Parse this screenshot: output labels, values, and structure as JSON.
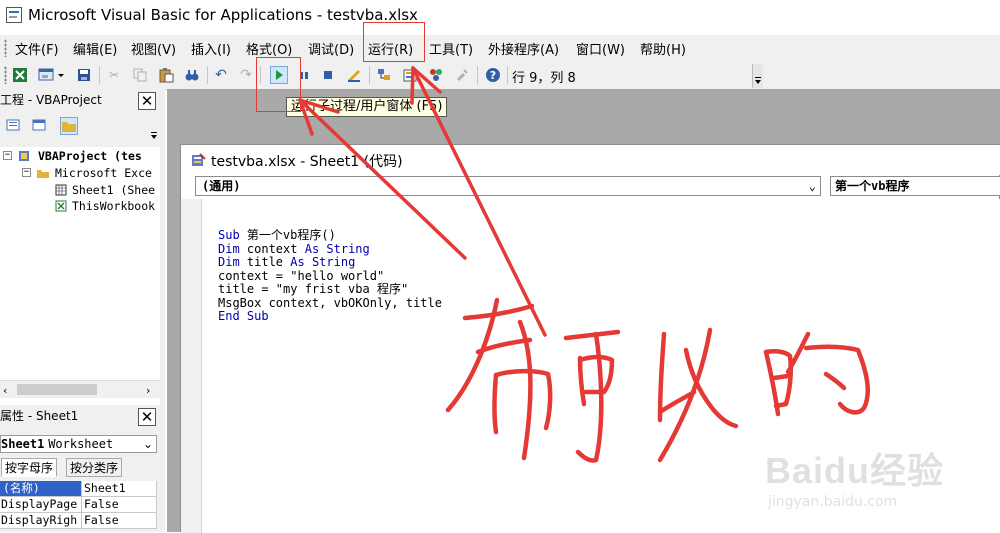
{
  "window": {
    "title": "Microsoft Visual Basic for Applications - testvba.xlsx"
  },
  "menu": {
    "items": [
      "文件(F)",
      "编辑(E)",
      "视图(V)",
      "插入(I)",
      "格式(O)",
      "调试(D)",
      "运行(R)",
      "工具(T)",
      "外接程序(A)",
      "窗口(W)",
      "帮助(H)"
    ]
  },
  "toolbar": {
    "position": "行 9，列 8",
    "tooltip": "运行子过程/用户窗体 (F5)"
  },
  "project_panel": {
    "title": "工程 - VBAProject",
    "tree": [
      "VBAProject (tes",
      "Microsoft Exce",
      "Sheet1 (Shee",
      "ThisWorkbook"
    ]
  },
  "properties_panel": {
    "title": "属性 - Sheet1",
    "object_name": "Sheet1",
    "object_type": "Worksheet",
    "tabs": [
      "按字母序",
      "按分类序"
    ],
    "rows": [
      {
        "name": "(名称)",
        "value": "Sheet1"
      },
      {
        "name": "DisplayPage",
        "value": "False"
      },
      {
        "name": "DisplayRigh",
        "value": "False"
      }
    ]
  },
  "code_window": {
    "title": "testvba.xlsx - Sheet1 (代码)",
    "object_combo": "(通用)",
    "proc_combo": "第一个vb程序",
    "lines": [
      {
        "kw": "Sub",
        "rest": " 第一个vb程序()"
      },
      {
        "kw": "Dim",
        "mid": " context ",
        "kw2": "As String"
      },
      {
        "kw": "Dim",
        "mid": " title ",
        "kw2": "As String"
      },
      {
        "text": "context = \"hello world\""
      },
      {
        "text": "title = \"my frist vba 程序\""
      },
      {
        "text": "MsgBox context, vbOKOnly, title"
      },
      {
        "kw": "End Sub"
      }
    ]
  },
  "watermark": {
    "logo": "Baidu经验",
    "url": "jingyan.baidu.com"
  },
  "colors": {
    "annotation_red": "#e53935",
    "keyword_blue": "#0000aa",
    "mdi_gray": "#a9a9a9"
  }
}
